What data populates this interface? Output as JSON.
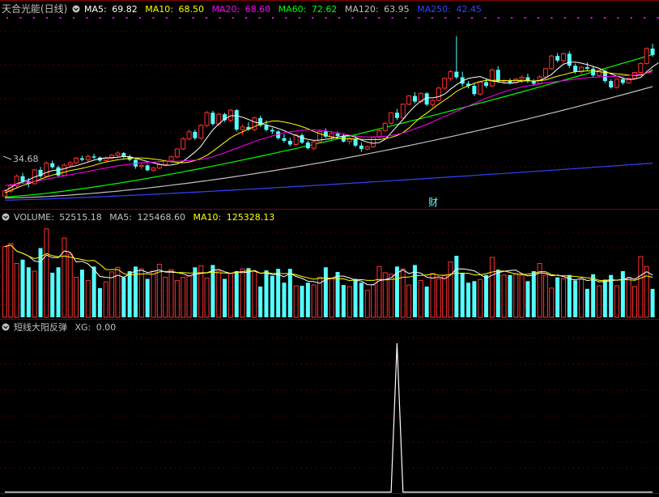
{
  "price_panel": {
    "title": "天合光能(日线)",
    "indicators": [
      {
        "label": "MA5:",
        "value": "69.82",
        "color": "#ffffff"
      },
      {
        "label": "MA10:",
        "value": "68.50",
        "color": "#ffff00"
      },
      {
        "label": "MA20:",
        "value": "68.60",
        "color": "#ff00ff"
      },
      {
        "label": "MA60:",
        "value": "72.62",
        "color": "#00ff00"
      },
      {
        "label": "MA120:",
        "value": "63.95",
        "color": "#c0c0c0"
      },
      {
        "label": "MA250:",
        "value": "42.45",
        "color": "#3344ff"
      }
    ],
    "low_label": "34.68",
    "marker": "财"
  },
  "volume_panel": {
    "indicators": [
      {
        "label": "VOLUME:",
        "value": "52515.18",
        "color": "#c0c0c0"
      },
      {
        "label": "MA5:",
        "value": "125468.60",
        "color": "#c0c0c0"
      },
      {
        "label": "MA10:",
        "value": "125328.13",
        "color": "#ffff00"
      }
    ]
  },
  "signal_panel": {
    "indicators": [
      {
        "label": "短线大阳反弹",
        "value": "",
        "color": "#c0c0c0"
      },
      {
        "label": "XG:",
        "value": "0.00",
        "color": "#c0c0c0"
      }
    ]
  },
  "colors": {
    "up": "#ff3232",
    "down": "#54ffff",
    "grid": "#800000",
    "ma5": "#ffffff",
    "ma10": "#ffff00",
    "ma20": "#ff00ff",
    "ma60": "#00ff00",
    "ma120": "#c0c0c0",
    "ma250": "#3344ff",
    "signal": "#ffffff"
  },
  "chart_data": [
    {
      "type": "candlestick",
      "price_range": [
        33,
        82
      ],
      "candles": [
        [
          34.7,
          36.6,
          34.6,
          36.1
        ],
        [
          36,
          38,
          35.5,
          37.5
        ],
        [
          37.5,
          40.5,
          37,
          40
        ],
        [
          40,
          40.9,
          38,
          38.6
        ],
        [
          38.6,
          39.5,
          37,
          38
        ],
        [
          38,
          42,
          37.8,
          41.7
        ],
        [
          41.7,
          42.5,
          39.5,
          40
        ],
        [
          40,
          44,
          39.8,
          43.5
        ],
        [
          43.5,
          44.2,
          42,
          42.4
        ],
        [
          42.4,
          42.9,
          39.8,
          40.2
        ],
        [
          40.2,
          43.5,
          40,
          43
        ],
        [
          43,
          44.1,
          42.5,
          43.6
        ],
        [
          43.6,
          45.2,
          43.3,
          44.8
        ],
        [
          44.8,
          45.5,
          44,
          44.4
        ],
        [
          44.4,
          45.8,
          43.9,
          45.3
        ],
        [
          45.3,
          46,
          44.6,
          45
        ],
        [
          45,
          45.3,
          43.8,
          44.2
        ],
        [
          44.2,
          45.3,
          43.8,
          44.8
        ],
        [
          44.8,
          46,
          44.6,
          45.6
        ],
        [
          45.6,
          46.7,
          45,
          46.2
        ],
        [
          46.2,
          46.5,
          44.8,
          45.3
        ],
        [
          45.3,
          45.8,
          44,
          44.4
        ],
        [
          44.4,
          44.6,
          42,
          42.6
        ],
        [
          42.6,
          43.5,
          41.8,
          42.9
        ],
        [
          42.9,
          43.2,
          41.3,
          41.6
        ],
        [
          41.6,
          42.5,
          41.2,
          42.2
        ],
        [
          42.2,
          43.5,
          41.9,
          43.1
        ],
        [
          43.1,
          44.5,
          42.8,
          44.1
        ],
        [
          44.1,
          45.5,
          43.6,
          45.2
        ],
        [
          45.2,
          47.5,
          44.8,
          47.3
        ],
        [
          47.3,
          50.5,
          47,
          50
        ],
        [
          50,
          52.5,
          49.6,
          51.9
        ],
        [
          51.9,
          52.5,
          49.7,
          50.2
        ],
        [
          50.2,
          54,
          49.8,
          53.6
        ],
        [
          53.6,
          57.5,
          53.2,
          57
        ],
        [
          57,
          57.5,
          53.5,
          54
        ],
        [
          54,
          57,
          53.4,
          56.6
        ],
        [
          56.6,
          57,
          54.5,
          55
        ],
        [
          55,
          58,
          54.4,
          57.7
        ],
        [
          57.7,
          58,
          52,
          52.5
        ],
        [
          52.5,
          53.8,
          51,
          53.2
        ],
        [
          53.2,
          54.5,
          52.2,
          52.5
        ],
        [
          52.5,
          56,
          52,
          55.6
        ],
        [
          55.6,
          56.2,
          53.2,
          53.6
        ],
        [
          53.6,
          55,
          52,
          52.4
        ],
        [
          52.4,
          53,
          51.3,
          52
        ],
        [
          52,
          52.3,
          49.8,
          50.2
        ],
        [
          50.2,
          51.3,
          49,
          49.5
        ],
        [
          49.5,
          50.3,
          48,
          48.5
        ],
        [
          48.5,
          51.5,
          48.2,
          51
        ],
        [
          51,
          51.5,
          48.6,
          49
        ],
        [
          49,
          49.5,
          47.2,
          47.5
        ],
        [
          47.5,
          49.5,
          47,
          49.2
        ],
        [
          49.2,
          52.5,
          48.8,
          52
        ],
        [
          52,
          52.8,
          50.2,
          50.6
        ],
        [
          50.6,
          52,
          49.8,
          51.4
        ],
        [
          51.4,
          52,
          50.5,
          50.8
        ],
        [
          50.8,
          51.5,
          49,
          49.3
        ],
        [
          49.3,
          50.5,
          48.5,
          50.1
        ],
        [
          50.1,
          50.6,
          47.8,
          48.2
        ],
        [
          48.2,
          49,
          46.5,
          47.3
        ],
        [
          47.3,
          48.2,
          46.9,
          47.9
        ],
        [
          47.9,
          50.8,
          47.6,
          50.5
        ],
        [
          50.5,
          52.5,
          50,
          52.2
        ],
        [
          52.2,
          54.5,
          52,
          54.2
        ],
        [
          54.2,
          57.2,
          53.8,
          57
        ],
        [
          57,
          58,
          55,
          55.6
        ],
        [
          55.6,
          59.5,
          55.3,
          59.3
        ],
        [
          59.3,
          61.8,
          59,
          61.5
        ],
        [
          61.5,
          62.5,
          59.5,
          60
        ],
        [
          60,
          62.5,
          59.5,
          62.2
        ],
        [
          62.2,
          62.5,
          58.8,
          59.2
        ],
        [
          59.2,
          60.5,
          58.5,
          60.3
        ],
        [
          60.3,
          64,
          60,
          63.6
        ],
        [
          63.6,
          66.5,
          63.2,
          66.2
        ],
        [
          66.2,
          68.5,
          65.5,
          68
        ],
        [
          68,
          77.5,
          66,
          66.5
        ],
        [
          66.5,
          68,
          64,
          64.8
        ],
        [
          64.8,
          65.5,
          63.5,
          64.2
        ],
        [
          64.2,
          64.8,
          61.5,
          62
        ],
        [
          62,
          65.5,
          61.6,
          65.2
        ],
        [
          65.2,
          66,
          63.7,
          64.2
        ],
        [
          64.2,
          68.8,
          63.9,
          68.5
        ],
        [
          68.5,
          69.5,
          65,
          65.4
        ],
        [
          65.4,
          66,
          64.7,
          65.6
        ],
        [
          65.6,
          66.2,
          64.6,
          65.1
        ],
        [
          65.1,
          66.3,
          64.8,
          66
        ],
        [
          66,
          67,
          64.9,
          66.5
        ],
        [
          66.5,
          67.5,
          65,
          65.5
        ],
        [
          65.5,
          66,
          64.2,
          64.8
        ],
        [
          64.8,
          67,
          64.5,
          66.6
        ],
        [
          66.6,
          69,
          66.2,
          68.8
        ],
        [
          68.8,
          72.5,
          68.5,
          72.2
        ],
        [
          72.2,
          73,
          70.5,
          71
        ],
        [
          71,
          73.2,
          70.2,
          72.8
        ],
        [
          72.8,
          73.5,
          69,
          69.6
        ],
        [
          69.6,
          70.2,
          67.5,
          68
        ],
        [
          68,
          69.5,
          67.2,
          69.2
        ],
        [
          69.2,
          70.5,
          68.4,
          68.8
        ],
        [
          68.8,
          69.5,
          66.5,
          67
        ],
        [
          67,
          68.5,
          66.7,
          68.2
        ],
        [
          68.2,
          68.5,
          65,
          65.5
        ],
        [
          65.5,
          66,
          63.5,
          63.8
        ],
        [
          63.8,
          66.2,
          63.5,
          66
        ],
        [
          66,
          66.5,
          64.5,
          65
        ],
        [
          65,
          66.5,
          64.8,
          66.2
        ],
        [
          66.2,
          68,
          66,
          67.8
        ],
        [
          67.8,
          70.5,
          67.5,
          70.2
        ],
        [
          70.2,
          74.5,
          70,
          74.2
        ],
        [
          74.2,
          75.5,
          72,
          72.5
        ]
      ],
      "ma_lines": {
        "ma5": [
          36,
          37,
          38,
          38.5,
          39,
          39.8,
          40.3,
          41,
          41.5,
          41.7,
          42,
          42.5,
          42.8,
          43.3,
          43.8,
          44.3,
          44.7,
          44.9,
          45,
          45.1,
          45.3,
          45.2,
          44.8,
          44.4,
          43.9,
          43.6,
          43.2,
          42.9,
          43,
          43.3,
          44,
          45.2,
          46.5,
          48,
          50.3,
          52.4,
          54,
          55.3,
          56.2,
          56.2,
          55.8,
          55.2,
          54.5,
          54.2,
          53.7,
          53.3,
          52.8,
          52.2,
          51.5,
          50.9,
          50.3,
          49.9,
          49.6,
          49.7,
          49.9,
          50.1,
          50.5,
          50.8,
          50.9,
          50.5,
          49.7,
          49.1,
          48.8,
          49,
          49.9,
          51.6,
          53.4,
          55.2,
          57.1,
          58.8,
          60.1,
          61,
          61,
          61.3,
          62,
          63.3,
          64.5,
          65.5,
          66.2,
          66.5,
          66.7,
          66.1,
          65.5,
          65.3,
          65,
          64.9,
          65.1,
          65.5,
          65.6,
          65.5,
          65.7,
          66.3,
          67.3,
          68.7,
          70,
          70.5,
          70.6,
          70.3,
          69.9,
          69.4,
          68.9,
          68.1,
          67.4,
          66.8,
          66.3,
          65.9,
          66,
          66.5,
          68,
          69.3,
          70.4
        ],
        "ma10": [
          35.5,
          36.2,
          36.9,
          37.5,
          38,
          38.6,
          39.2,
          39.8,
          40.3,
          40.7,
          41.1,
          41.5,
          41.8,
          42.1,
          42.5,
          42.9,
          43.4,
          43.8,
          44.1,
          44.4,
          44.6,
          44.8,
          44.9,
          44.9,
          44.8,
          44.6,
          44.4,
          44.1,
          43.9,
          43.7,
          43.6,
          43.8,
          44.2,
          44.8,
          45.6,
          46.7,
          47.9,
          49.1,
          50.3,
          51.2,
          51.9,
          52.6,
          53.3,
          54,
          54.4,
          54.8,
          54.8,
          54.5,
          54.2,
          53.8,
          53.3,
          52.7,
          52,
          51.4,
          50.9,
          50.5,
          50.2,
          50.1,
          50,
          50,
          49.9,
          49.8,
          49.8,
          49.8,
          50.1,
          50.4,
          50.9,
          51.7,
          52.9,
          54.4,
          55.8,
          56.9,
          58.1,
          59.3,
          60.4,
          61.5,
          62.7,
          63.6,
          64.2,
          64.9,
          65.4,
          65.7,
          65.7,
          65.7,
          65.6,
          65.6,
          65.7,
          65.6,
          65.6,
          65.5,
          65.6,
          65.8,
          66.3,
          66.8,
          67.2,
          67.6,
          68,
          68.1,
          68.2,
          68.2,
          68,
          67.8,
          67.6,
          67.4,
          67.3,
          67.1,
          67,
          67.1,
          67.6,
          68.5
        ],
        "ma20": [
          37.5,
          37.7,
          37.9,
          38.1,
          38.3,
          38.6,
          38.9,
          39.2,
          39.5,
          39.8,
          40.1,
          40.4,
          40.7,
          41,
          41.3,
          41.6,
          41.9,
          42.2,
          42.5,
          42.8,
          43,
          43.2,
          43.4,
          43.6,
          43.7,
          43.8,
          43.9,
          44,
          44,
          44,
          44.1,
          44.2,
          44.3,
          44.5,
          44.8,
          45.2,
          45.7,
          46.3,
          46.9,
          47.5,
          48.1,
          48.7,
          49.3,
          49.8,
          50.3,
          50.8,
          51.2,
          51.6,
          51.9,
          52.1,
          52.3,
          52.4,
          52.4,
          52.3,
          52.1,
          51.9,
          51.6,
          51.3,
          51,
          50.8,
          50.6,
          50.5,
          50.5,
          50.6,
          50.7,
          50.9,
          51.2,
          51.6,
          52.1,
          52.7,
          53.3,
          53.9,
          54.6,
          55.3,
          56,
          56.7,
          57.4,
          58.1,
          58.8,
          59.5,
          60.2,
          60.9,
          61.5,
          62.1,
          62.6,
          63.1,
          63.5,
          63.9,
          64.2,
          64.5,
          64.7,
          65,
          65.2,
          65.4,
          65.6,
          65.8,
          66,
          66.2,
          66.4,
          66.5,
          66.6,
          66.7,
          66.7,
          66.8,
          66.9,
          67,
          67.1,
          67.3,
          67.6,
          68
        ]
      }
    },
    {
      "type": "bar",
      "series": [
        {
          "name": "VOLUME",
          "values": [
            92,
            96,
            70,
            75,
            65,
            60,
            90,
            115,
            58,
            65,
            103,
            82,
            52,
            62,
            48,
            66,
            38,
            46,
            59,
            65,
            52,
            60,
            66,
            63,
            50,
            60,
            69,
            52,
            62,
            48,
            52,
            54,
            65,
            67,
            51,
            68,
            60,
            50,
            57,
            60,
            63,
            64,
            60,
            40,
            61,
            54,
            63,
            45,
            63,
            41,
            41,
            45,
            42,
            52,
            65,
            50,
            59,
            42,
            40,
            50,
            45,
            35,
            42,
            66,
            58,
            56,
            66,
            63,
            42,
            68,
            48,
            40,
            57,
            50,
            55,
            72,
            80,
            58,
            45,
            47,
            49,
            55,
            78,
            62,
            55,
            55,
            57,
            55,
            47,
            60,
            70,
            55,
            38,
            52,
            50,
            55,
            48,
            49,
            37,
            56,
            41,
            49,
            55,
            41,
            60,
            52,
            40,
            79,
            66,
            37
          ]
        }
      ]
    },
    {
      "type": "line",
      "series": [
        {
          "name": "XG",
          "values": [
            0,
            0,
            0,
            0,
            0,
            0,
            0,
            0,
            0,
            0,
            0,
            0,
            0,
            0,
            0,
            0,
            0,
            0,
            0,
            0,
            0,
            0,
            0,
            0,
            0,
            0,
            0,
            0,
            0,
            0,
            0,
            0,
            0,
            0,
            0,
            0,
            0,
            0,
            0,
            0,
            0,
            0,
            0,
            0,
            0,
            0,
            0,
            0,
            0,
            0,
            0,
            0,
            0,
            0,
            0,
            0,
            0,
            0,
            0,
            0,
            0,
            0,
            0,
            0,
            0,
            0,
            1,
            0,
            0,
            0,
            0,
            0,
            0,
            0,
            0,
            0,
            0,
            0,
            0,
            0,
            0,
            0,
            0,
            0,
            0,
            0,
            0,
            0,
            0,
            0,
            0,
            0,
            0,
            0,
            0,
            0,
            0,
            0,
            0,
            0,
            0,
            0,
            0,
            0,
            0,
            0,
            0,
            0,
            0,
            0
          ]
        }
      ]
    }
  ]
}
